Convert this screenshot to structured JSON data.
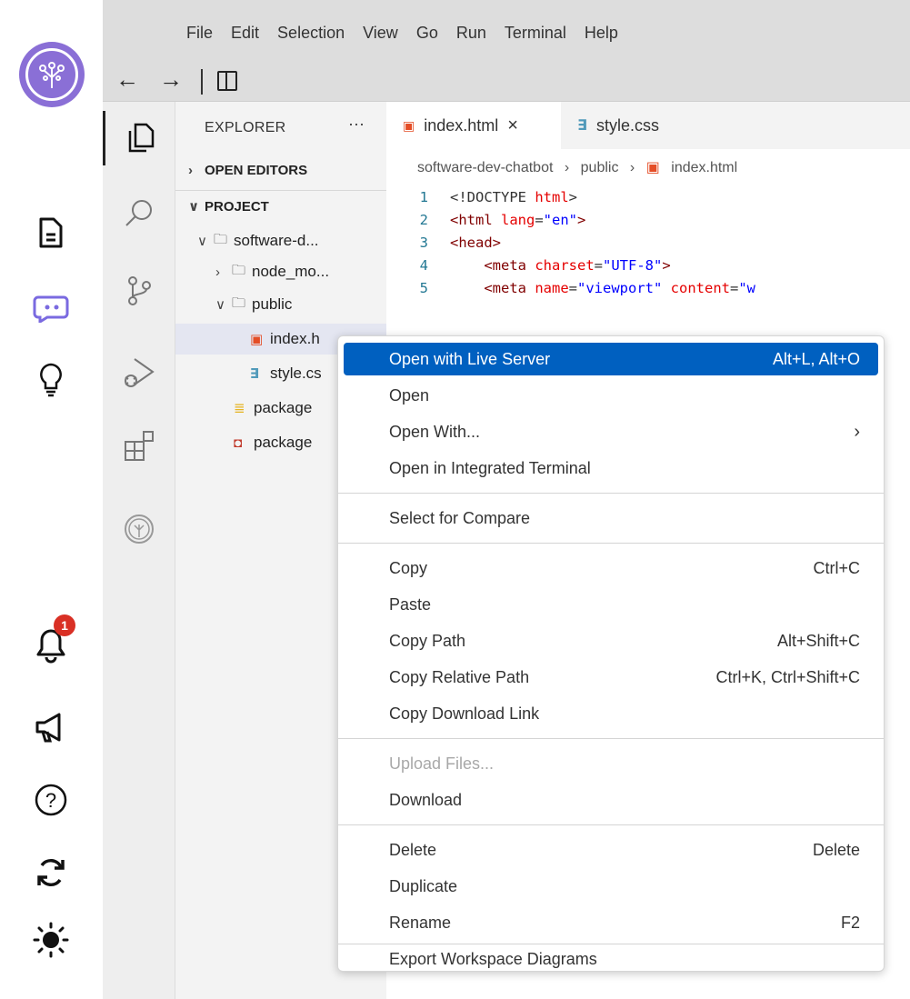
{
  "menubar": {
    "items": [
      "File",
      "Edit",
      "Selection",
      "View",
      "Go",
      "Run",
      "Terminal",
      "Help"
    ]
  },
  "nav": {
    "back": "←",
    "forward": "→"
  },
  "rail": {
    "notification_count": "1"
  },
  "explorer": {
    "title": "EXPLORER",
    "more": "···",
    "open_editors": "OPEN EDITORS",
    "project": "PROJECT",
    "tree": [
      {
        "label": "software-d...",
        "chev": "∨"
      },
      {
        "label": "node_mo...",
        "chev": "›"
      },
      {
        "label": "public",
        "chev": "∨"
      },
      {
        "label": "index.h"
      },
      {
        "label": "style.cs"
      },
      {
        "label": "package"
      },
      {
        "label": "package"
      }
    ]
  },
  "tabs": [
    {
      "label": "index.html",
      "close": "×"
    },
    {
      "label": "style.css"
    }
  ],
  "breadcrumb": {
    "p1": "software-dev-chatbot",
    "sep": "›",
    "p2": "public",
    "p3": "index.html"
  },
  "code": {
    "lines": [
      {
        "n": "1",
        "a": "<!DOCTYPE ",
        "b": "html",
        "c": ">"
      },
      {
        "n": "2",
        "a": "<html ",
        "b": "lang",
        "c": "=",
        "d": "\"en\"",
        "e": ">"
      },
      {
        "n": "3",
        "a": "<head>"
      },
      {
        "n": "4",
        "a": "    <meta ",
        "b": "charset",
        "c": "=",
        "d": "\"UTF-8\"",
        "e": ">"
      },
      {
        "n": "5",
        "a": "    <meta ",
        "b": "name",
        "c": "=",
        "d": "\"viewport\"",
        "e": " ",
        "f": "content",
        "g": "=",
        "h": "\"w"
      }
    ]
  },
  "context_menu": {
    "groups": [
      [
        {
          "label": "Open with Live Server",
          "key": "Alt+L, Alt+O",
          "highlight": true
        },
        {
          "label": "Open"
        },
        {
          "label": "Open With...",
          "key": "›"
        },
        {
          "label": "Open in Integrated Terminal"
        }
      ],
      [
        {
          "label": "Select for Compare"
        }
      ],
      [
        {
          "label": "Copy",
          "key": "Ctrl+C"
        },
        {
          "label": "Paste"
        },
        {
          "label": "Copy Path",
          "key": "Alt+Shift+C"
        },
        {
          "label": "Copy Relative Path",
          "key": "Ctrl+K, Ctrl+Shift+C"
        },
        {
          "label": "Copy Download Link"
        }
      ],
      [
        {
          "label": "Upload Files...",
          "disabled": true
        },
        {
          "label": "Download"
        }
      ],
      [
        {
          "label": "Delete",
          "key": "Delete"
        },
        {
          "label": "Duplicate"
        },
        {
          "label": "Rename",
          "key": "F2"
        }
      ],
      [
        {
          "label": "Export Workspace Diagrams"
        }
      ]
    ]
  },
  "colors": {
    "highlight": "#0060c0",
    "rail_logo": "#8a6fd6",
    "badge": "#d93025"
  }
}
